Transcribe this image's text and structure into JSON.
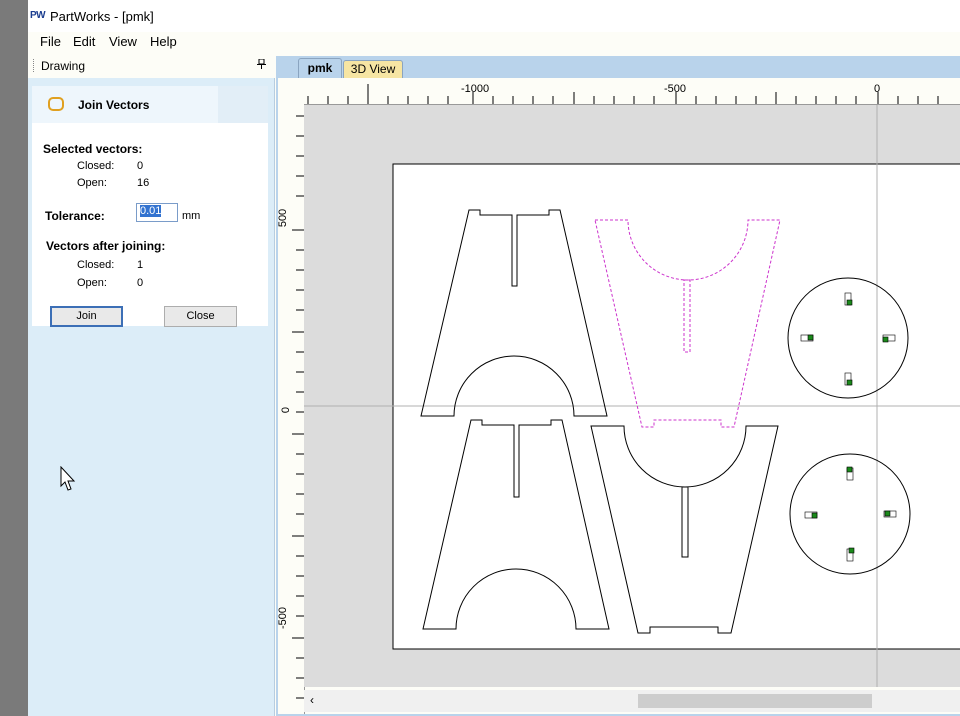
{
  "window": {
    "app_icon": "PW",
    "title": "PartWorks - [pmk]"
  },
  "menu": [
    "File",
    "Edit",
    "View",
    "Help"
  ],
  "panel": {
    "title": "Drawing",
    "pin_icon": "pin-icon"
  },
  "join_vectors": {
    "title": "Join Vectors",
    "icon": "join-vectors-icon",
    "selected_heading": "Selected vectors:",
    "closed_label": "Closed:",
    "closed_value": "0",
    "open_label": "Open:",
    "open_value": "16",
    "tolerance_label": "Tolerance:",
    "tolerance_value": "0.01",
    "tolerance_unit": "mm",
    "after_heading": "Vectors after joining:",
    "after_closed_label": "Closed:",
    "after_closed_value": "1",
    "after_open_label": "Open:",
    "after_open_value": "0",
    "join_button": "Join",
    "close_button": "Close"
  },
  "tabs": [
    "pmk",
    "3D View"
  ],
  "ruler": {
    "horizontal_labels": [
      "-1000",
      "-500",
      "0"
    ],
    "vertical_labels": [
      "500",
      "0",
      "-500"
    ]
  },
  "colors": {
    "selected_vector": "#cc33cc",
    "node_marker": "#1a8a1a",
    "panel_bg": "#dcedf8",
    "tab_3d_bg": "#f6e5a3"
  }
}
